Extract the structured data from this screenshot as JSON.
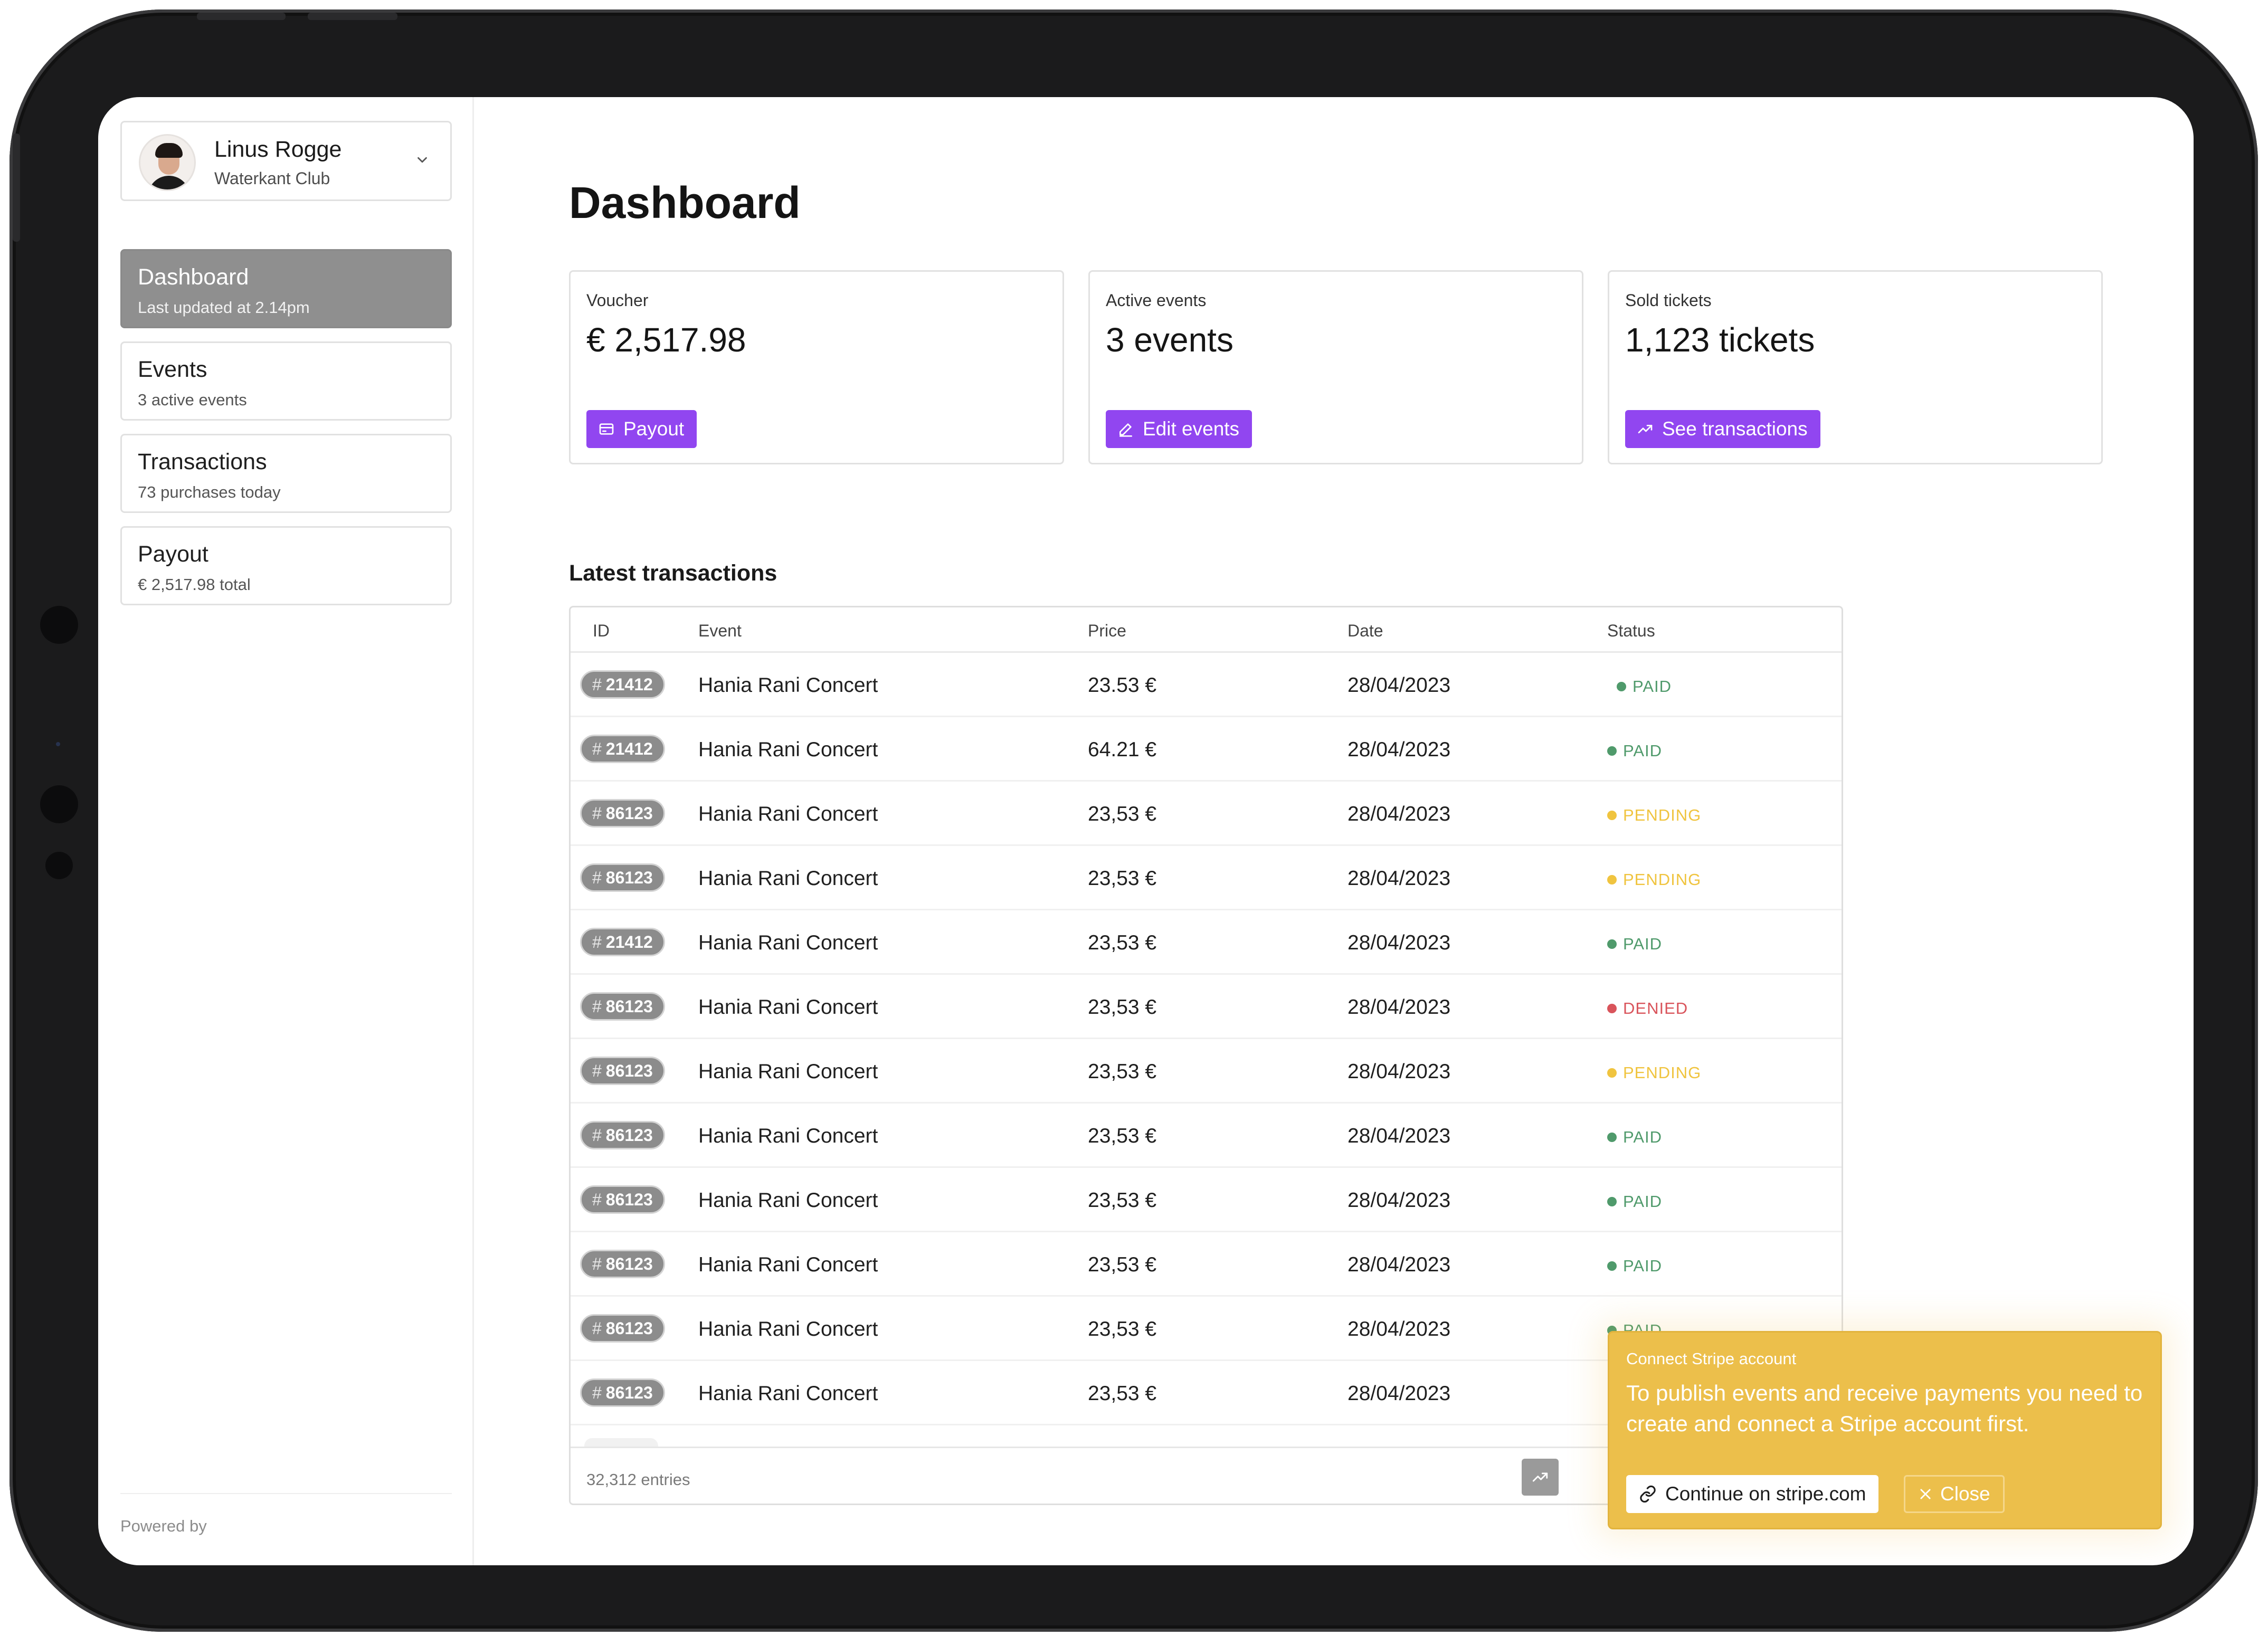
{
  "user": {
    "name": "Linus Rogge",
    "club": "Waterkant Club"
  },
  "nav": [
    {
      "title": "Dashboard",
      "subtitle": "Last updated at 2.14pm",
      "active": true
    },
    {
      "title": "Events",
      "subtitle": "3 active events",
      "active": false
    },
    {
      "title": "Transactions",
      "subtitle": "73 purchases today",
      "active": false
    },
    {
      "title": "Payout",
      "subtitle": "€ 2,517.98 total",
      "active": false
    }
  ],
  "footer": {
    "powered_by": "Powered by"
  },
  "page": {
    "title": "Dashboard"
  },
  "stats": [
    {
      "label": "Voucher",
      "value": "€ 2,517.98",
      "button": "Payout",
      "icon": "wallet-icon"
    },
    {
      "label": "Active events",
      "value": "3 events",
      "button": "Edit events",
      "icon": "pencil-icon"
    },
    {
      "label": "Sold tickets",
      "value": "1,123 tickets",
      "button": "See transactions",
      "icon": "trend-up-icon"
    }
  ],
  "transactions": {
    "title": "Latest transactions",
    "columns": [
      "ID",
      "Event",
      "Price",
      "Date",
      "Status"
    ],
    "rows": [
      {
        "id": "21412",
        "event": "Hania Rani Concert",
        "price": "23.53 €",
        "date": "28/04/2023",
        "status": "PAID"
      },
      {
        "id": "21412",
        "event": "Hania Rani Concert",
        "price": "64.21 €",
        "date": "28/04/2023",
        "status": "PAID"
      },
      {
        "id": "86123",
        "event": "Hania Rani Concert",
        "price": "23,53 €",
        "date": "28/04/2023",
        "status": "PENDING"
      },
      {
        "id": "86123",
        "event": "Hania Rani Concert",
        "price": "23,53 €",
        "date": "28/04/2023",
        "status": "PENDING"
      },
      {
        "id": "21412",
        "event": "Hania Rani Concert",
        "price": "23,53 €",
        "date": "28/04/2023",
        "status": "PAID"
      },
      {
        "id": "86123",
        "event": "Hania Rani Concert",
        "price": "23,53 €",
        "date": "28/04/2023",
        "status": "DENIED"
      },
      {
        "id": "86123",
        "event": "Hania Rani Concert",
        "price": "23,53 €",
        "date": "28/04/2023",
        "status": "PENDING"
      },
      {
        "id": "86123",
        "event": "Hania Rani Concert",
        "price": "23,53 €",
        "date": "28/04/2023",
        "status": "PAID"
      },
      {
        "id": "86123",
        "event": "Hania Rani Concert",
        "price": "23,53 €",
        "date": "28/04/2023",
        "status": "PAID"
      },
      {
        "id": "86123",
        "event": "Hania Rani Concert",
        "price": "23,53 €",
        "date": "28/04/2023",
        "status": "PAID"
      },
      {
        "id": "86123",
        "event": "Hania Rani Concert",
        "price": "23,53 €",
        "date": "28/04/2023",
        "status": "PAID"
      },
      {
        "id": "86123",
        "event": "Hania Rani Concert",
        "price": "23,53 €",
        "date": "28/04/2023",
        "status": ""
      }
    ],
    "entries": "32,312 entries",
    "status_colors": {
      "PAID": "#4f9a6b",
      "PENDING": "#f0c43f",
      "DENIED": "#d9545b"
    }
  },
  "toast": {
    "title": "Connect Stripe account",
    "body": "To publish events and receive payments you need to create and connect a Stripe account first.",
    "primary_label": "Continue on stripe.com",
    "secondary_label": "Close"
  },
  "colors": {
    "accent": "#9146f0",
    "toast": "#ecbf4b",
    "nav_active": "#8f8f8f"
  }
}
